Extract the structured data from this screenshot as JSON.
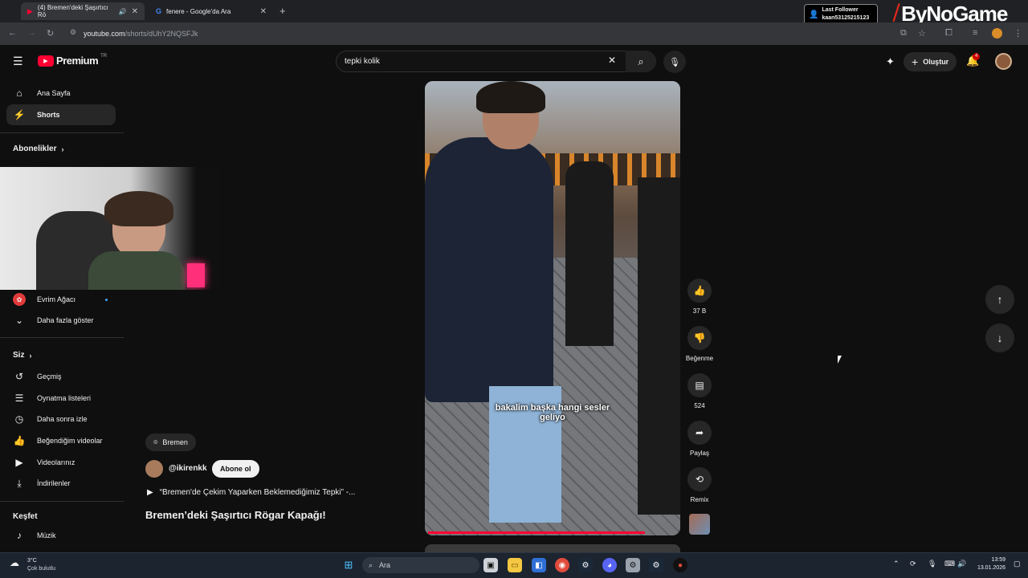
{
  "browser": {
    "tabs": [
      {
        "label": "(4) Bremen'deki Şaşırtıcı Rö"
      },
      {
        "label": "fenere - Google'da Ara"
      }
    ],
    "url_host": "youtube.com",
    "url_path": "/shorts/dUhY2NQSFJk"
  },
  "overlay": {
    "follower_title": "Last Follower",
    "follower_name": "kaan53125215123",
    "brand": "ByNoGame"
  },
  "header": {
    "logo": "Premium",
    "logo_region": "TR",
    "search_value": "tepki kolik",
    "create_label": "Oluştur",
    "notification_count": "4"
  },
  "sidebar": {
    "main": [
      {
        "label": "Ana Sayfa"
      },
      {
        "label": "Shorts"
      }
    ],
    "subs_heading": "Abonelikler",
    "subs": [
      {
        "label": "Evrim Ağacı"
      },
      {
        "label": "Daha fazla göster"
      }
    ],
    "you_heading": "Siz",
    "you": [
      {
        "label": "Geçmiş"
      },
      {
        "label": "Oynatma listeleri"
      },
      {
        "label": "Daha sonra izle"
      },
      {
        "label": "Beğendiğim videolar"
      },
      {
        "label": "Videolarınız"
      },
      {
        "label": "İndirilenler"
      }
    ],
    "explore_heading": "Keşfet",
    "explore": [
      {
        "label": "Müzik"
      }
    ]
  },
  "short": {
    "location": "Bremen",
    "channel": "@ikirenkk",
    "subscribe_label": "Abone ol",
    "related": "“Bremen'de Çekim Yaparken Beklemediğimiz Tepki” -...",
    "title": "Bremen’deki Şaşırtıcı Rögar Kapağı!",
    "caption_line1": "bakalim başka hangi sesler",
    "caption_line2": "geliyo",
    "likes": "37 B",
    "dislike_label": "Beğenme",
    "comments": "524",
    "share_label": "Paylaş",
    "remix_label": "Remix"
  },
  "taskbar": {
    "weather_temp": "3°C",
    "weather_desc": "Çok bulutlu",
    "search_placeholder": "Ara",
    "time": "13:59",
    "date": "13.01.2026"
  },
  "colors": {
    "yt_red": "#ff0033",
    "background": "#0f0f0f"
  }
}
